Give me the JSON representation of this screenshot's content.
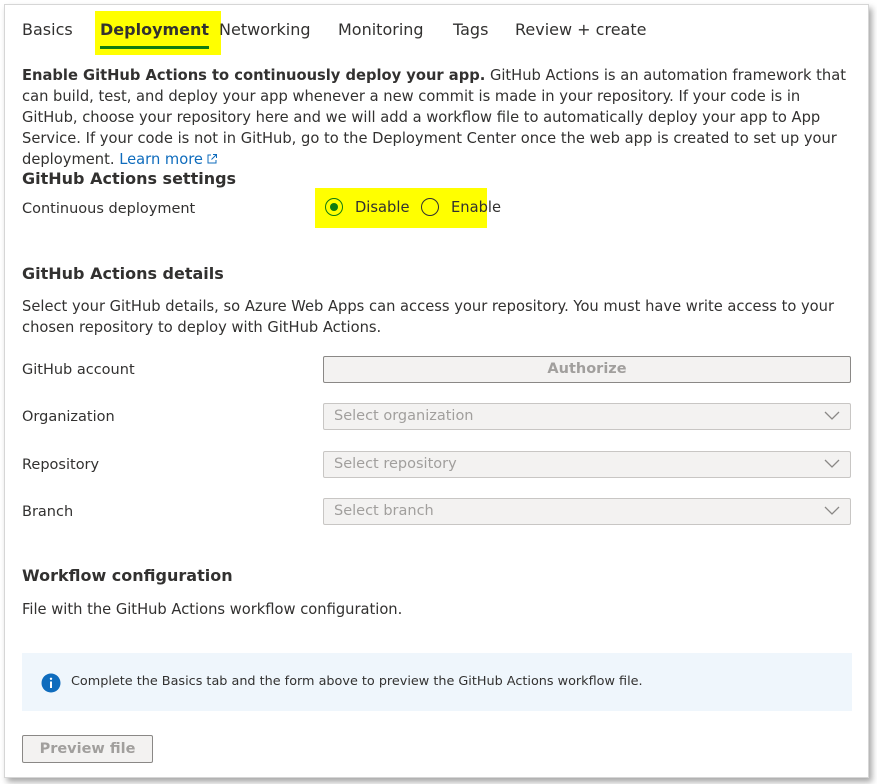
{
  "tabs": [
    {
      "label": "Basics"
    },
    {
      "label": "Deployment"
    },
    {
      "label": "Networking"
    },
    {
      "label": "Monitoring"
    },
    {
      "label": "Tags"
    },
    {
      "label": "Review + create"
    }
  ],
  "active_tab": "Deployment",
  "intro": {
    "bold": "Enable GitHub Actions to continuously deploy your app.",
    "text": " GitHub Actions is an automation framework that can build, test, and deploy your app whenever a new commit is made in your repository. If your code is in GitHub, choose your repository here and we will add a workflow file to automatically deploy your app to App Service. If your code is not in GitHub, go to the Deployment Center once the web app is created to set up your deployment. ",
    "link": "Learn more"
  },
  "settings": {
    "title": "GitHub Actions settings",
    "cd_label": "Continuous deployment",
    "options": [
      {
        "label": "Disable",
        "checked": true
      },
      {
        "label": "Enable",
        "checked": false
      }
    ]
  },
  "details": {
    "title": "GitHub Actions details",
    "description": "Select your GitHub details, so Azure Web Apps can access your repository. You must have write access to your chosen repository to deploy with GitHub Actions.",
    "account_label": "GitHub account",
    "authorize_label": "Authorize",
    "organization_label": "Organization",
    "organization_placeholder": "Select organization",
    "repository_label": "Repository",
    "repository_placeholder": "Select repository",
    "branch_label": "Branch",
    "branch_placeholder": "Select branch"
  },
  "workflow": {
    "title": "Workflow configuration",
    "description": "File with the GitHub Actions workflow configuration.",
    "info_text": "Complete the Basics tab and the form above to preview the GitHub Actions workflow file.",
    "preview_label": "Preview file"
  },
  "colors": {
    "highlight": "#ffff00",
    "accent_green": "#107c10",
    "link_blue": "#0f6cbd",
    "info_bg": "#eff6fc",
    "info_icon": "#0f6cbd"
  }
}
